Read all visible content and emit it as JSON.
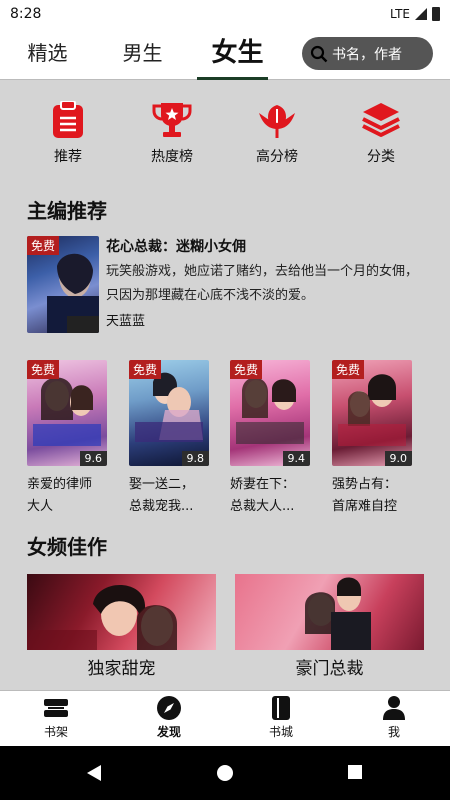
{
  "status": {
    "time": "8:28",
    "network": "LTE"
  },
  "top_nav": {
    "tabs": [
      {
        "label": "精选"
      },
      {
        "label": "男生"
      },
      {
        "label": "女生"
      }
    ],
    "active_index": 2,
    "search_placeholder": "书名，作者"
  },
  "categories": [
    {
      "label": "推荐",
      "icon": "clipboard-icon"
    },
    {
      "label": "热度榜",
      "icon": "trophy-icon"
    },
    {
      "label": "高分榜",
      "icon": "flower-icon"
    },
    {
      "label": "分类",
      "icon": "layers-icon"
    }
  ],
  "editor_pick": {
    "title": "主编推荐",
    "featured": {
      "free_tag": "免费",
      "title": "花心总裁：迷糊小女佣",
      "description": "玩笑般游戏，她应诺了赌约，去给他当一个月的女佣，只因为那埋藏在心底不浅不淡的爱。",
      "author": "天蓝蓝"
    },
    "books": [
      {
        "free_tag": "免费",
        "score": "9.6",
        "title_line1": "亲爱的律师",
        "title_line2": "大人"
      },
      {
        "free_tag": "免费",
        "score": "9.8",
        "title_line1": "娶一送二，",
        "title_line2": "总裁宠我..."
      },
      {
        "free_tag": "免费",
        "score": "9.4",
        "title_line1": "娇妻在下：",
        "title_line2": "总裁大人..."
      },
      {
        "free_tag": "免费",
        "score": "9.0",
        "title_line1": "强势占有：",
        "title_line2": "首席难自控"
      }
    ]
  },
  "female_picks": {
    "title": "女频佳作",
    "banners": [
      {
        "label": "独家甜宠"
      },
      {
        "label": "豪门总裁"
      }
    ]
  },
  "bottom_nav": {
    "items": [
      {
        "label": "书架",
        "icon": "bookshelf-icon"
      },
      {
        "label": "发现",
        "icon": "compass-icon"
      },
      {
        "label": "书城",
        "icon": "book-icon"
      },
      {
        "label": "我",
        "icon": "person-icon"
      }
    ],
    "active_index": 1
  },
  "colors": {
    "accent_red": "#e0171e",
    "nav_active": "#1b3d26",
    "background": "#d4d4d4"
  }
}
